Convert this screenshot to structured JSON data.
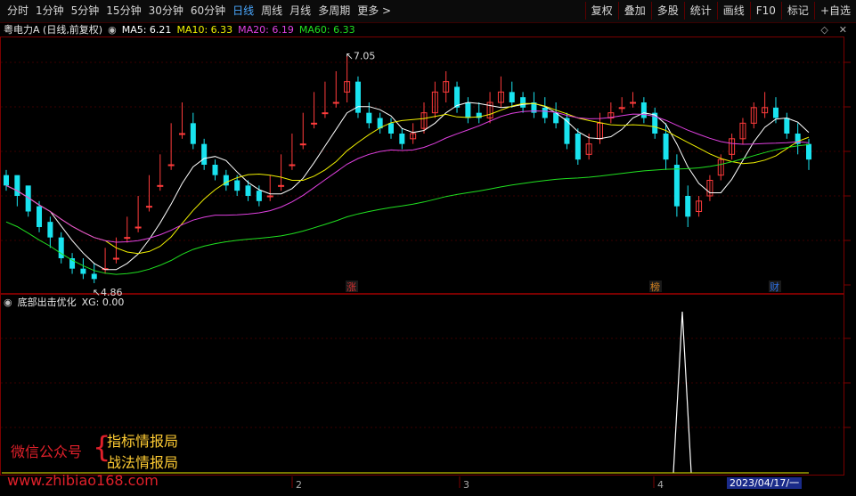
{
  "toolbar": {
    "periods": [
      "分时",
      "1分钟",
      "5分钟",
      "15分钟",
      "30分钟",
      "60分钟",
      "日线",
      "周线",
      "月线",
      "多周期",
      "更多 >"
    ],
    "active_index": 6,
    "right_buttons": [
      "复权",
      "叠加",
      "多股",
      "统计",
      "画线",
      "F10",
      "标记",
      "+自选"
    ]
  },
  "stock": {
    "title": "粤电力A (日线,前复权)",
    "ma5": "MA5: 6.21",
    "ma10": "MA10: 6.33",
    "ma20": "MA20: 6.19",
    "ma60": "MA60: 6.33",
    "high_label": "7.05",
    "low_label": "4.86",
    "marker_zhang": "涨",
    "marker_bang": "榜",
    "marker_cai": "财"
  },
  "indicator": {
    "name": "底部出击优化",
    "xg": "XG: 0.00"
  },
  "wechat": {
    "prefix": "微信公众号",
    "line1": "指标情报局",
    "line2": "战法情报局"
  },
  "watermark": "www.zhibiao168.com",
  "axis": {
    "months": [
      "2",
      "3",
      "4"
    ],
    "cursor_date": "2023/04/17/一"
  },
  "colors": {
    "up": "#ff3b3b",
    "down": "#19e3ef",
    "ma5": "#ffffff",
    "ma10": "#f0f000",
    "ma20": "#e040e0",
    "ma60": "#20e020",
    "active": "#4aa8ff"
  }
}
